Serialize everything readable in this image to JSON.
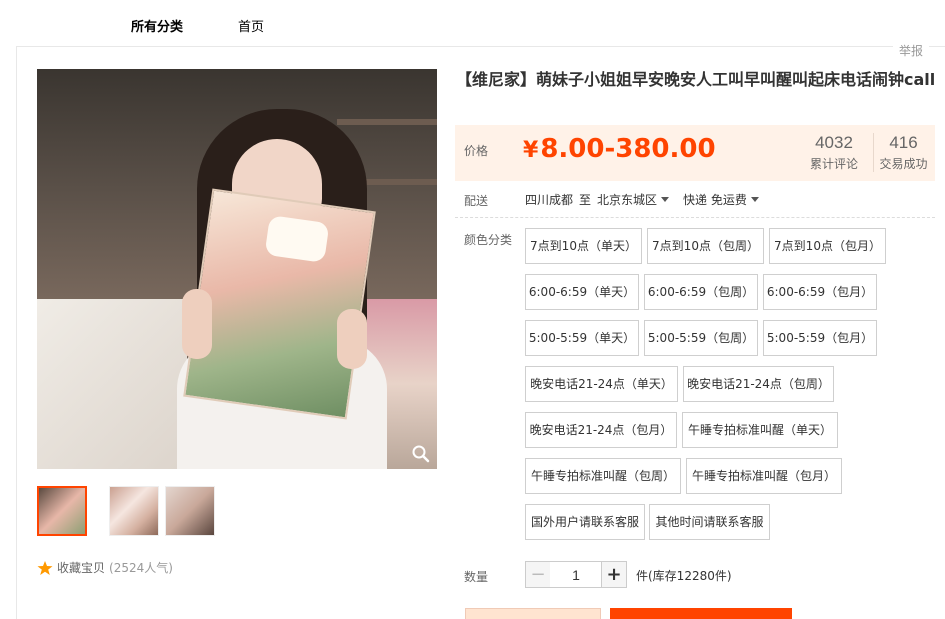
{
  "nav": {
    "all_categories": "所有分类",
    "home": "首页"
  },
  "report": "举报",
  "title": "【维尼家】萌妹子小姐姐早安晚安人工叫早叫醒叫起床电话闹钟call",
  "price": {
    "label": "价格",
    "currency": "¥",
    "value": "8.00-380.00"
  },
  "stats": {
    "reviews_count": "4032",
    "reviews_label": "累计评论",
    "sales_count": "416",
    "sales_label": "交易成功"
  },
  "shipping": {
    "label": "配送",
    "from": "四川成都",
    "to_word": "至",
    "to": "北京东城区",
    "method": "快递 免运费"
  },
  "color": {
    "label": "颜色分类",
    "options": [
      "7点到10点（单天）",
      "7点到10点（包周）",
      "7点到10点（包月）",
      "6:00-6:59（单天）",
      "6:00-6:59（包周）",
      "6:00-6:59（包月）",
      "5:00-5:59（单天）",
      "5:00-5:59（包周）",
      "5:00-5:59（包月）",
      "晚安电话21-24点（单天）",
      "晚安电话21-24点（包周）",
      "晚安电话21-24点（包月）",
      "午睡专拍标准叫醒（单天）",
      "午睡专拍标准叫醒（包周）",
      "午睡专拍标准叫醒（包月）",
      "国外用户请联系客服",
      "其他时间请联系客服"
    ]
  },
  "quantity": {
    "label": "数量",
    "minus": "−",
    "plus": "+",
    "value": "1",
    "unit_stock": "件(库存12280件)"
  },
  "favorite": {
    "label": "收藏宝贝",
    "count": "(2524人气)"
  },
  "colors": {
    "accent": "#ff4400",
    "price_bg": "#fff2e8"
  },
  "icons": {
    "zoom": "magnifier-icon",
    "favorite": "star-icon",
    "dropdown": "caret-down-icon"
  }
}
